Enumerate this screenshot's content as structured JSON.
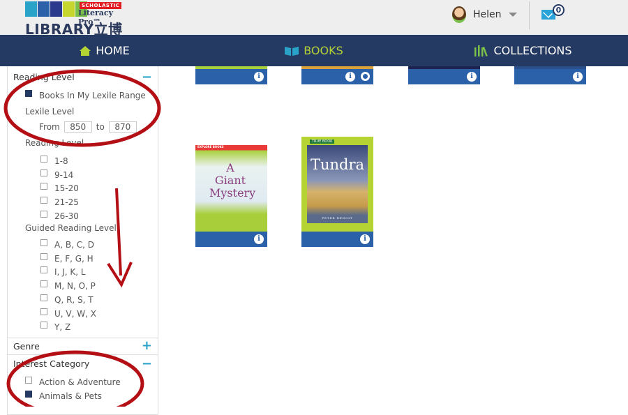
{
  "header": {
    "logo": {
      "brand": "SCHOLASTIC",
      "product": "Literacy Pro™",
      "name": "LIBRARY立博",
      "colors": [
        "#2aa3c8",
        "#2a61a8",
        "#2b3a8c",
        "#c7d62f",
        "#7ac04a"
      ]
    },
    "user": {
      "name": "Helen"
    },
    "messages": {
      "count": "0"
    }
  },
  "nav": {
    "items": [
      {
        "label": "HOME",
        "icon": "home-icon"
      },
      {
        "label": "BOOKS",
        "icon": "book-icon",
        "active": true
      },
      {
        "label": "COLLECTIONS",
        "icon": "collections-icon"
      }
    ]
  },
  "sidebar": {
    "reading_level": {
      "title": "Reading Level",
      "toggle": "−",
      "my_range": {
        "label": "Books In My Lexile Range",
        "checked": true
      },
      "lexile": {
        "label": "Lexile Level",
        "from_label": "From",
        "from": "850",
        "to_label": "to",
        "to": "870"
      },
      "reading_level_sub": "Reading Level",
      "levels": [
        "1-8",
        "9-14",
        "15-20",
        "21-25",
        "26-30"
      ],
      "guided_label": "Guided Reading Level",
      "guided": [
        "A, B, C, D",
        "E, F, G, H",
        "I, J, K, L",
        "M, N, O, P",
        "Q, R, S, T",
        "U, V, W, X",
        "Y, Z"
      ]
    },
    "genre": {
      "title": "Genre",
      "toggle": "+"
    },
    "interest": {
      "title": "Interest Category",
      "toggle": "−",
      "items": [
        {
          "label": "Action & Adventure",
          "checked": false
        },
        {
          "label": "Animals & Pets",
          "checked": true
        }
      ]
    }
  },
  "books": {
    "row2": [
      {
        "title": "A Giant Mystery",
        "series": "EXPLORE BOOKS"
      },
      {
        "title": "Tundra",
        "series": "TRUE BOOK",
        "author": "PETER BENOIT"
      }
    ],
    "info_label": "i"
  },
  "colors": {
    "nav": "#253a63",
    "accent": "#b6d334",
    "bar": "#2a61a8",
    "annotation": "#b30f14"
  }
}
